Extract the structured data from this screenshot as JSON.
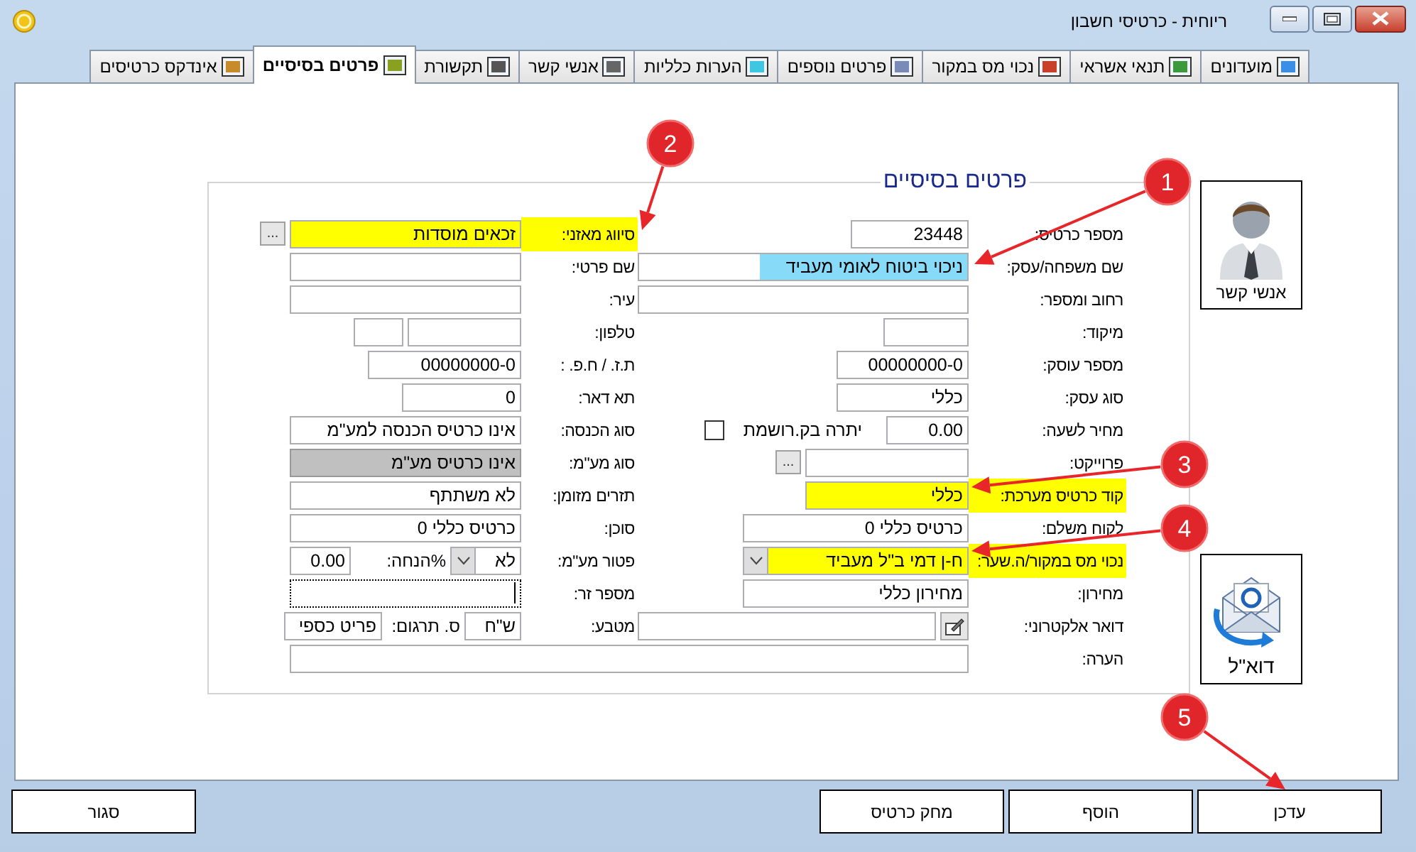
{
  "window": {
    "title": "ריוחית - כרטיסי חשבון"
  },
  "tabs": [
    {
      "label": "מועדונים",
      "selected": false
    },
    {
      "label": "תנאי אשראי",
      "selected": false
    },
    {
      "label": "נכוי מס במקור",
      "selected": false
    },
    {
      "label": "פרטים נוספים",
      "selected": false
    },
    {
      "label": "הערות כלליות",
      "selected": false
    },
    {
      "label": "אנשי קשר",
      "selected": false
    },
    {
      "label": "תקשורת",
      "selected": false
    },
    {
      "label": "פרטים בסיסיים",
      "selected": true
    },
    {
      "label": "אינדקס כרטיסים",
      "selected": false
    }
  ],
  "form": {
    "title": "פרטים בסיסיים",
    "right": [
      {
        "kind": "text",
        "label": "מספר כרטיס:",
        "value": "23448"
      },
      {
        "kind": "marked",
        "label": "שם משפחה/עסק:",
        "value": "ניכוי ביטוח לאומי מעביד",
        "color": "#87daf8"
      },
      {
        "kind": "text",
        "label": "רחוב ומספר:"
      },
      {
        "kind": "text",
        "label": "מיקוד:"
      },
      {
        "kind": "text",
        "label": "מספר עוסק:",
        "value": "00000000-0"
      },
      {
        "kind": "text",
        "label": "סוג עסק:",
        "value": "כללי"
      },
      {
        "kind": "checkbox",
        "label": "מחיר לשעה:",
        "value": "0.00",
        "check_label": "יתרה בק.רושמת",
        "checked": false
      },
      {
        "kind": "ellipsis",
        "label": "פרוייקט:",
        "button": "..."
      },
      {
        "kind": "text",
        "label": "קוד כרטיס מערכת:",
        "value": "כללי",
        "color": "#ffff00"
      },
      {
        "kind": "text",
        "label": "לקוח משלם:",
        "value": "כרטיס כללי 0"
      },
      {
        "kind": "dropdown",
        "label": "נכוי מס במקור/ה.שער:",
        "value": "ח-ן דמי ב\"ל מעביד",
        "color": "#ffff00"
      },
      {
        "kind": "text",
        "label": "מחירון:",
        "value": "מחירון כללי"
      },
      {
        "kind": "email",
        "label": "דואר אלקטרוני:"
      },
      {
        "kind": "text",
        "label": "הערה:"
      }
    ],
    "left": [
      {
        "kind": "ellipsis",
        "label": "סיווג מאזני:",
        "value": "זכאים מוסדות",
        "button": "...",
        "color": "#ffff00",
        "disabled": false,
        "focused": false
      },
      {
        "kind": "text",
        "label": "שם פרטי:",
        "disabled": false,
        "focused": false
      },
      {
        "kind": "text",
        "label": "עיר:",
        "disabled": false,
        "focused": false
      },
      {
        "kind": "phone",
        "label": "טלפון:",
        "disabled": false,
        "focused": false
      },
      {
        "kind": "text",
        "label": "ת.ז. / ח.פ. :",
        "value": "00000000-0",
        "disabled": false,
        "focused": false
      },
      {
        "kind": "text",
        "label": "תא דאר:",
        "value": "0",
        "disabled": false,
        "focused": false
      },
      {
        "kind": "text",
        "label": "סוג הכנסה:",
        "value": "אינו כרטיס הכנסה למע\"מ",
        "disabled": false,
        "focused": false
      },
      {
        "kind": "text",
        "label": "סוג מע\"מ:",
        "value": "אינו כרטיס מע\"מ",
        "disabled": true,
        "focused": false
      },
      {
        "kind": "text",
        "label": "תזרים מזומן:",
        "value": "לא משתתף",
        "disabled": false,
        "focused": false
      },
      {
        "kind": "text",
        "label": "סוכן:",
        "value": "כרטיס כללי 0",
        "disabled": false,
        "focused": false
      },
      {
        "kind": "discount",
        "label": "פטור מע\"מ:",
        "value": "לא",
        "extra_label": "%הנחה:",
        "extra_value": "0.00",
        "disabled": false,
        "focused": false
      },
      {
        "kind": "text",
        "label": "מספר זר:",
        "disabled": false,
        "focused": true
      },
      {
        "kind": "currency",
        "label": "מטבע:",
        "value": "ש\"ח",
        "extra_label": "ס. תרגום:",
        "extra_value": "פריט כספי",
        "disabled": false,
        "focused": false
      }
    ]
  },
  "side_buttons": [
    {
      "kind": "contacts",
      "label": "אנשי קשר"
    },
    {
      "kind": "email",
      "label": "דוא\"ל"
    }
  ],
  "buttons": [
    {
      "label": "עדכן"
    },
    {
      "label": "הוסף"
    },
    {
      "label": "מחק כרטיס"
    },
    {
      "label": "סגור"
    }
  ],
  "callouts": [
    {
      "number": "1"
    },
    {
      "number": "2"
    },
    {
      "number": "3"
    },
    {
      "number": "4"
    },
    {
      "number": "5"
    }
  ]
}
